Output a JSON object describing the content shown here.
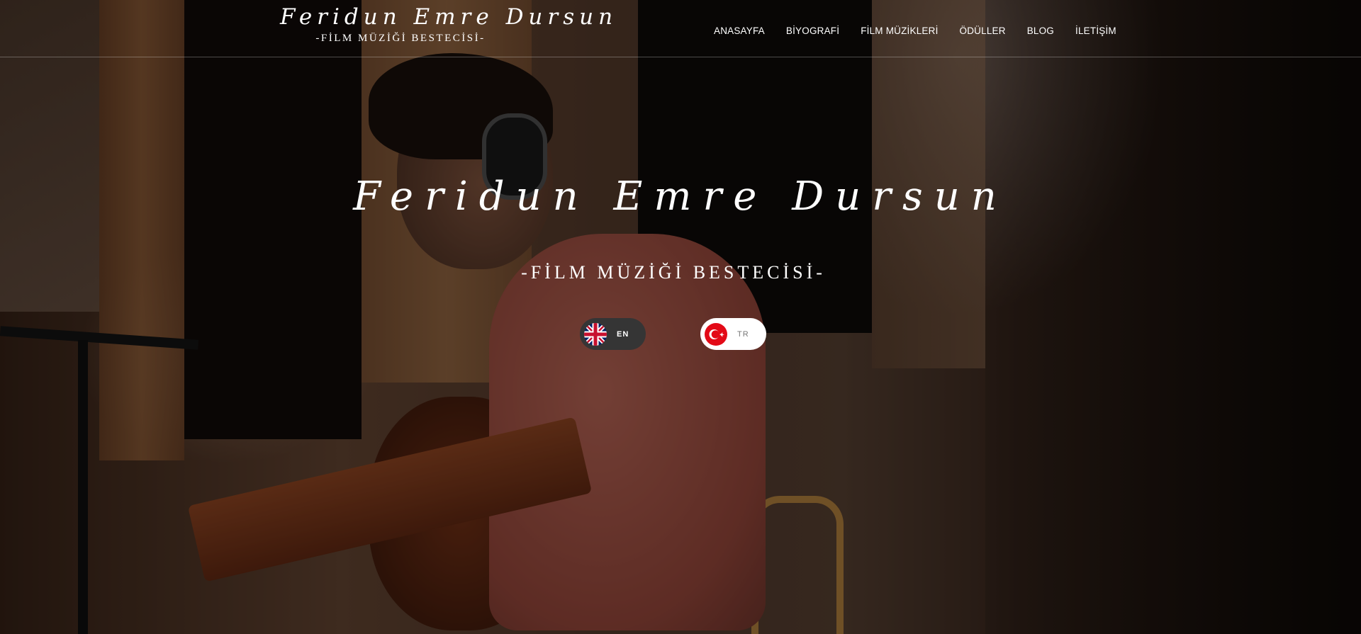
{
  "header": {
    "logo_name": "Feridun Emre Dursun",
    "logo_subtitle": "-FİLM MÜZİĞİ BESTECİSİ-"
  },
  "nav": {
    "items": [
      {
        "label": "ANASAYFA"
      },
      {
        "label": "BİYOGRAFİ"
      },
      {
        "label": "FİLM MÜZİKLERİ"
      },
      {
        "label": "ÖDÜLLER"
      },
      {
        "label": "BLOG"
      },
      {
        "label": "İLETİŞİM"
      }
    ]
  },
  "hero": {
    "title": "Feridun Emre Dursun",
    "subtitle": "-FİLM MÜZİĞİ BESTECİSİ-"
  },
  "languages": [
    {
      "label": "EN",
      "icon": "uk-flag-icon"
    },
    {
      "label": "TR",
      "icon": "turkey-flag-icon"
    }
  ],
  "colors": {
    "en_button_bg": "#353535",
    "tr_button_bg": "#ffffff",
    "text": "#ffffff",
    "turkey_red": "#e30a17"
  }
}
